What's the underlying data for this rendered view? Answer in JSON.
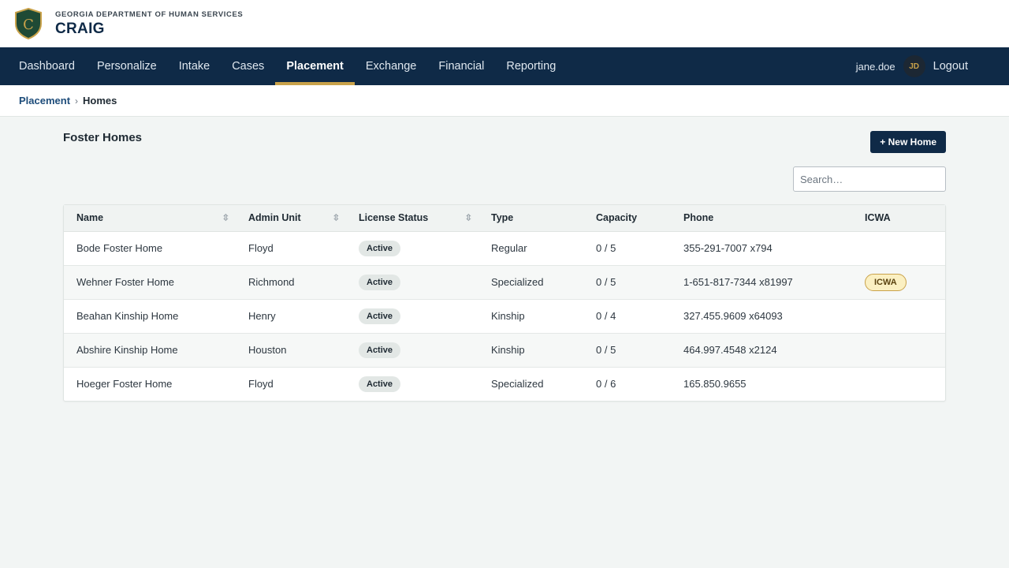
{
  "header": {
    "org": "GEORGIA DEPARTMENT OF HUMAN SERVICES",
    "app": "CRAIG",
    "logo_letter": "C"
  },
  "nav": {
    "items": [
      "Dashboard",
      "Personalize",
      "Intake",
      "Cases",
      "Placement",
      "Exchange",
      "Financial",
      "Reporting"
    ],
    "active": "Placement",
    "username": "jane.doe",
    "avatar_initials": "JD",
    "logout": "Logout"
  },
  "breadcrumb": {
    "parent": "Placement",
    "current": "Homes"
  },
  "page": {
    "title": "Foster Homes",
    "new_button": "+ New Home",
    "search_placeholder": "Search…"
  },
  "table": {
    "columns": [
      "Name",
      "Admin Unit",
      "License Status",
      "Type",
      "Capacity",
      "Phone",
      "ICWA"
    ],
    "rows": [
      {
        "name": "Bode Foster Home",
        "unit": "Floyd",
        "status": "Active",
        "type": "Regular",
        "capacity": "0 / 5",
        "phone": "355-291-7007 x794",
        "icwa": ""
      },
      {
        "name": "Wehner Foster Home",
        "unit": "Richmond",
        "status": "Active",
        "type": "Specialized",
        "capacity": "0 / 5",
        "phone": "1-651-817-7344 x81997",
        "icwa": "ICWA"
      },
      {
        "name": "Beahan Kinship Home",
        "unit": "Henry",
        "status": "Active",
        "type": "Kinship",
        "capacity": "0 / 4",
        "phone": "327.455.9609 x64093",
        "icwa": ""
      },
      {
        "name": "Abshire Kinship Home",
        "unit": "Houston",
        "status": "Active",
        "type": "Kinship",
        "capacity": "0 / 5",
        "phone": "464.997.4548 x2124",
        "icwa": ""
      },
      {
        "name": "Hoeger Foster Home",
        "unit": "Floyd",
        "status": "Active",
        "type": "Specialized",
        "capacity": "0 / 6",
        "phone": "165.850.9655",
        "icwa": ""
      }
    ]
  },
  "colors": {
    "navy": "#0f2a47",
    "gold": "#c9a24a",
    "background": "#f2f5f4"
  }
}
